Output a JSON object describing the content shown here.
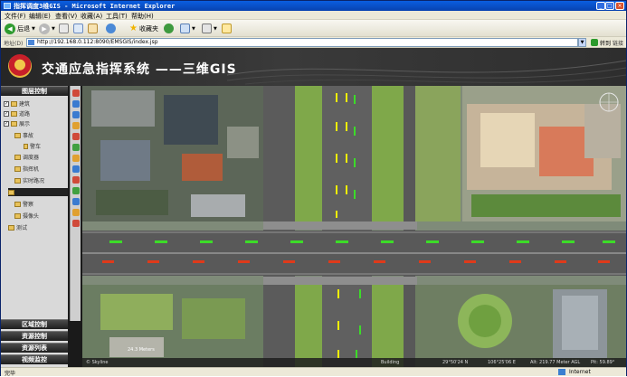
{
  "window": {
    "title": "指挥调度3维GIS - Microsoft Internet Explorer"
  },
  "menu": [
    "文件(F)",
    "编辑(E)",
    "查看(V)",
    "收藏(A)",
    "工具(T)",
    "帮助(H)"
  ],
  "toolbar": {
    "back_label": "后退",
    "favorites_label": "收藏夹"
  },
  "address": {
    "label": "地址(D)",
    "url": "http://192.168.0.112:8090/EMSGIS/index.jsp",
    "go_label": "转到",
    "links_label": "链接"
  },
  "banner": {
    "title": "交通应急指挥系统 ——三维GIS"
  },
  "left_panel": {
    "layer_control": "图层控制",
    "tree": [
      {
        "label": "建筑",
        "level": 0,
        "checked": true
      },
      {
        "label": "道路",
        "level": 0,
        "checked": true
      },
      {
        "label": "展示",
        "level": 0,
        "checked": true
      },
      {
        "label": "事故",
        "level": 1,
        "checked": false
      },
      {
        "label": "警车",
        "level": 2,
        "checked": false
      },
      {
        "label": "调度器",
        "level": 1,
        "checked": false
      },
      {
        "label": "指挥机",
        "level": 1,
        "checked": false
      },
      {
        "label": "实时路况",
        "level": 1,
        "checked": false
      },
      {
        "label": "",
        "level": 1,
        "checked": false,
        "selected": true
      },
      {
        "label": "警察",
        "level": 1,
        "checked": false
      },
      {
        "label": "摄像头",
        "level": 1,
        "checked": false
      },
      {
        "label": "测试",
        "level": 0,
        "checked": false
      }
    ],
    "bottom_sections": [
      "区域控制",
      "资源控制",
      "资源列表",
      "视频监控"
    ]
  },
  "map": {
    "scale_text": "24.3 Meters",
    "logo_text": "© Skyline",
    "status_building": "Building",
    "status_lat": "29°50'24 N",
    "status_lon": "106°25'06 E",
    "status_alt": "Alt: 219.77 Meter AGL",
    "status_pitch": "Pit: 59.89°"
  },
  "statusbar": {
    "left": "完毕",
    "zone": "Internet"
  },
  "colors": {
    "banner_bg": "#2e2e2e",
    "arrow_green": "#3cdc28",
    "arrow_red": "#e03a1a",
    "arrow_yellow": "#f2f200"
  }
}
